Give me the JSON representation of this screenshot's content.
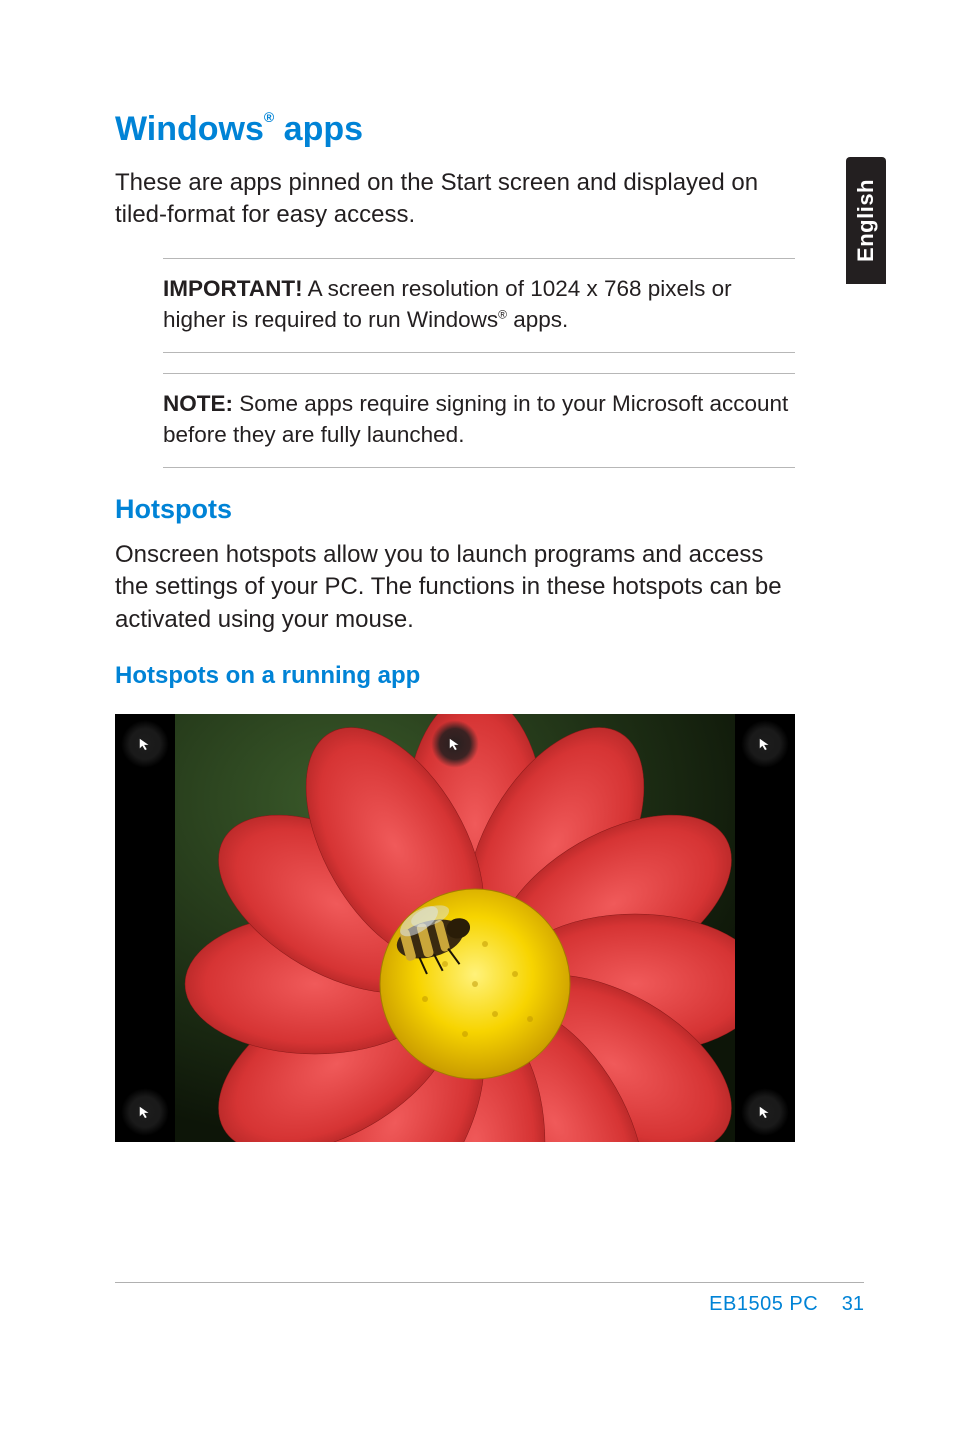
{
  "side_tab": "English",
  "heading_main_pre": "Windows",
  "heading_main_sup": "®",
  "heading_main_post": " apps",
  "intro_paragraph": "These are apps pinned on the Start screen and displayed on tiled-format for easy access.",
  "important": {
    "label": "IMPORTANT!",
    "text_pre": "   A screen resolution of 1024 x 768 pixels or higher is required to run Windows",
    "sup": "®",
    "text_post": " apps."
  },
  "note": {
    "label": "NOTE:",
    "text": "    Some apps require signing in to your Microsoft account before they are fully launched."
  },
  "heading_hotspots": "Hotspots",
  "hotspots_paragraph": "Onscreen hotspots allow you to launch programs and access the settings of your PC. The functions in these hotspots can be activated using your mouse.",
  "heading_hotspots_running": "Hotspots on a running app",
  "footer": {
    "product": "EB1505 PC",
    "page": "31"
  },
  "screenshot_watermark": ""
}
